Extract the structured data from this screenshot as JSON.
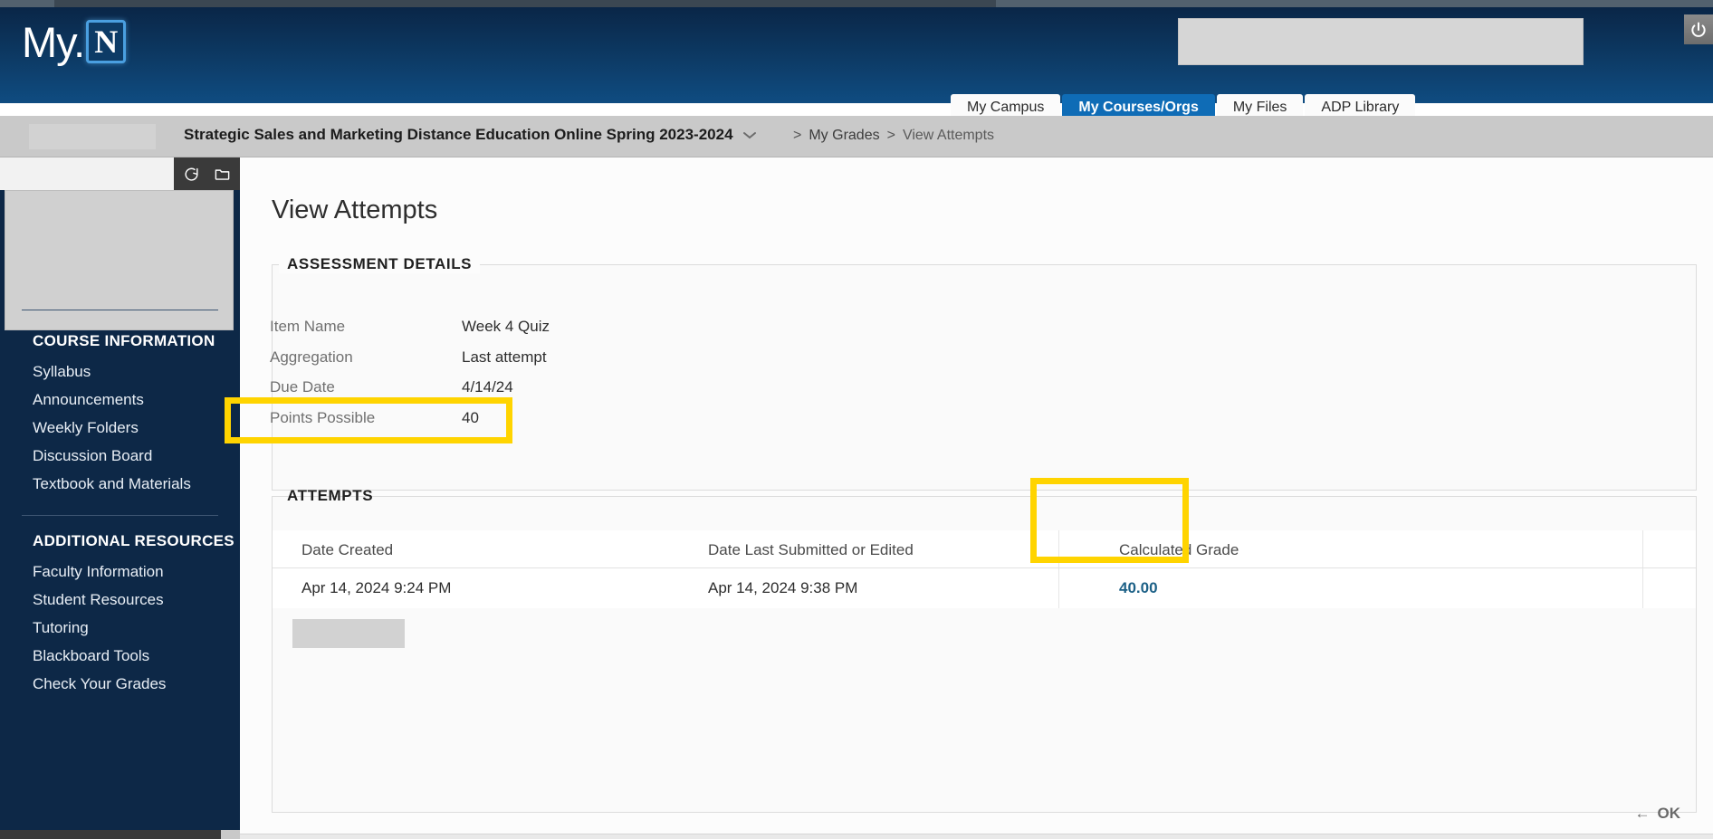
{
  "browser": {
    "chrome_label": ""
  },
  "header": {
    "logo_text": "My.",
    "logo_mark": "N",
    "power_icon": "power-icon",
    "link_icon": "link-icon"
  },
  "tabs": [
    {
      "label": "My Campus",
      "active": false
    },
    {
      "label": "My Courses/Orgs",
      "active": true
    },
    {
      "label": "My Files",
      "active": false
    },
    {
      "label": "ADP Library",
      "active": false
    }
  ],
  "breadcrumb": {
    "course": "Strategic Sales and Marketing Distance Education Online Spring 2023-2024",
    "chevron": "chevron-down-icon",
    "sep1": ">",
    "item1": "My Grades",
    "sep2": ">",
    "current": "View Attempts"
  },
  "sidebar": {
    "toolbar": {
      "refresh_icon": "refresh-icon",
      "folder_icon": "folder-icon"
    },
    "sections": [
      {
        "title": "COURSE INFORMATION",
        "items": [
          "Syllabus",
          "Announcements",
          "Weekly Folders",
          "Discussion Board",
          "Textbook and Materials"
        ]
      },
      {
        "title": "ADDITIONAL RESOURCES",
        "items": [
          "Faculty Information",
          "Student Resources",
          "Tutoring",
          "Blackboard Tools",
          "Check Your Grades"
        ]
      }
    ]
  },
  "main": {
    "page_title": "View Attempts",
    "assessment": {
      "legend": "ASSESSMENT DETAILS",
      "rows": [
        {
          "label": "Item Name",
          "value": "Week 4 Quiz"
        },
        {
          "label": "Aggregation",
          "value": "Last attempt"
        },
        {
          "label": "Due Date",
          "value": "4/14/24"
        },
        {
          "label": "Points Possible",
          "value": "40"
        }
      ]
    },
    "attempts": {
      "legend": "ATTEMPTS",
      "columns": [
        "Date Created",
        "Date Last Submitted or Edited",
        "Calculated Grade"
      ],
      "rows": [
        {
          "date_created": "Apr 14, 2024 9:24 PM",
          "date_submitted": "Apr 14, 2024 9:38 PM",
          "calculated_grade": "40.00"
        }
      ]
    },
    "ok_button": {
      "arrow": "←",
      "label": "OK"
    }
  },
  "highlights": {
    "color": "#ffd400",
    "boxes": [
      "points-possible-row",
      "calculated-grade-column"
    ]
  }
}
